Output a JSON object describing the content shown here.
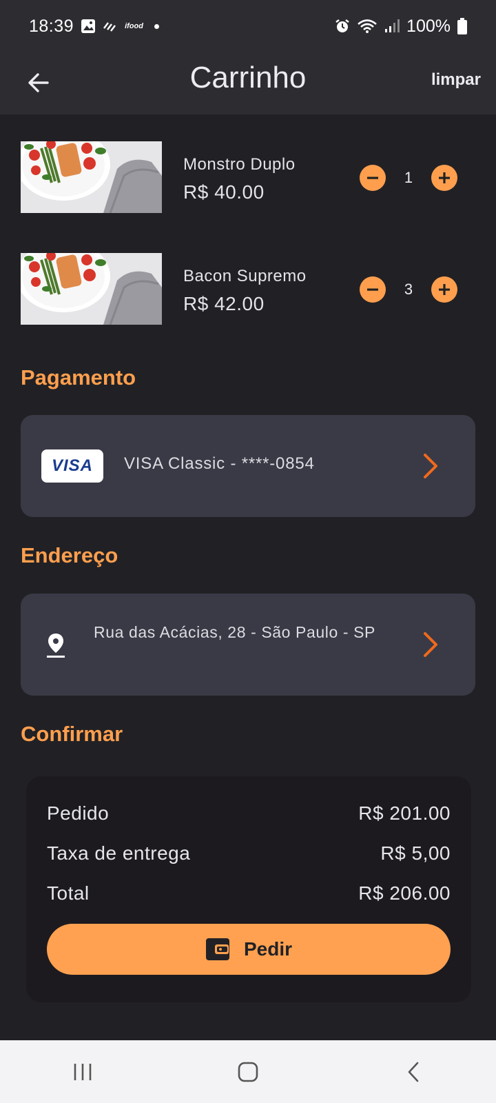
{
  "status_bar": {
    "time": "18:39",
    "app_label": "ifood",
    "battery": "100%",
    "icons": [
      "gallery-icon",
      "stripes-icon",
      "ifood-icon",
      "dot-icon",
      "alarm-icon",
      "wifi-icon",
      "signal-icon",
      "battery-icon"
    ]
  },
  "app_bar": {
    "title": "Carrinho",
    "clear_label": "limpar",
    "back_icon": "arrow-back-icon"
  },
  "cart": {
    "items": [
      {
        "name": "Monstro Duplo",
        "price": "R$ 40.00",
        "quantity": "1"
      },
      {
        "name": "Bacon Supremo",
        "price": "R$ 42.00",
        "quantity": "3"
      }
    ]
  },
  "payment": {
    "section_title": "Pagamento",
    "card_brand": "VISA",
    "card_label": "VISA Classic  -  ****-0854"
  },
  "address": {
    "section_title": "Endereço",
    "text": "Rua das Acácias, 28 - São Paulo - SP"
  },
  "confirm": {
    "section_title": "Confirmar",
    "rows": [
      {
        "label": "Pedido",
        "value": "R$ 201.00"
      },
      {
        "label": "Taxa de entrega",
        "value": "R$ 5,00"
      },
      {
        "label": "Total",
        "value": "R$ 206.00"
      }
    ],
    "order_button": "Pedir"
  },
  "colors": {
    "accent": "#ff9f4e",
    "background": "#212125",
    "bar": "#2c2c31",
    "card": "#3a3a46",
    "chevron": "#f06a1c"
  }
}
